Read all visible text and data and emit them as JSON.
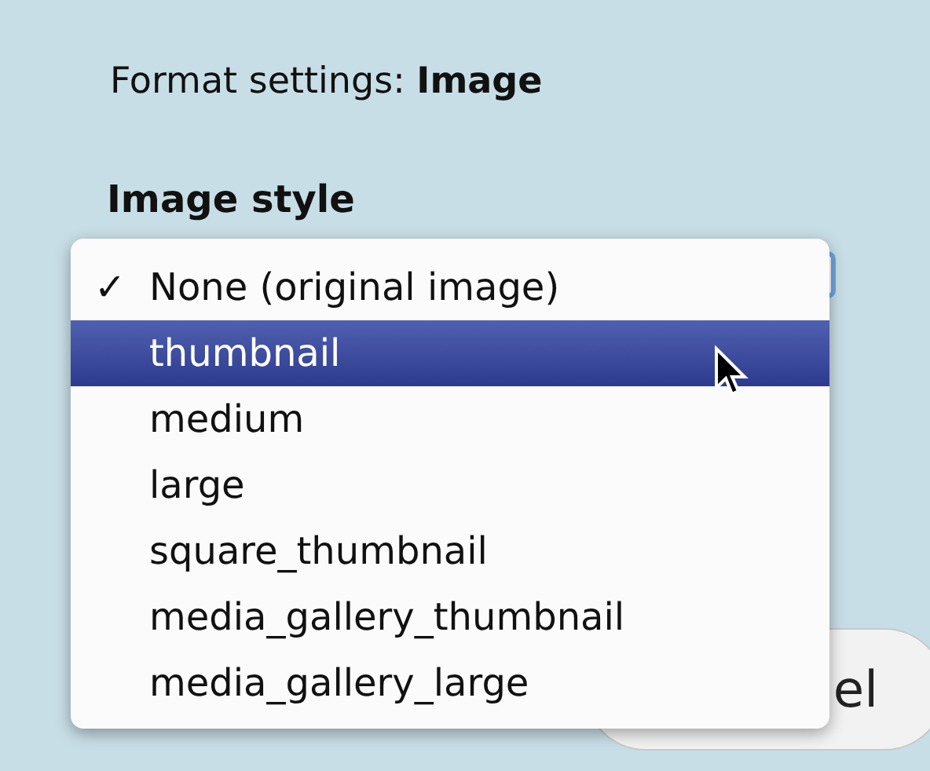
{
  "title": {
    "label": "Format settings: ",
    "value": "Image"
  },
  "image_style": {
    "heading": "Image style"
  },
  "menu": {
    "items": [
      {
        "label": "None (original image)",
        "checked": true,
        "selected": false
      },
      {
        "label": "thumbnail",
        "checked": false,
        "selected": true
      },
      {
        "label": "medium",
        "checked": false,
        "selected": false
      },
      {
        "label": "large",
        "checked": false,
        "selected": false
      },
      {
        "label": "square_thumbnail",
        "checked": false,
        "selected": false
      },
      {
        "label": "media_gallery_thumbnail",
        "checked": false,
        "selected": false
      },
      {
        "label": "media_gallery_large",
        "checked": false,
        "selected": false
      }
    ],
    "check_mark": "✓"
  },
  "cancel_button": {
    "label": "el"
  }
}
